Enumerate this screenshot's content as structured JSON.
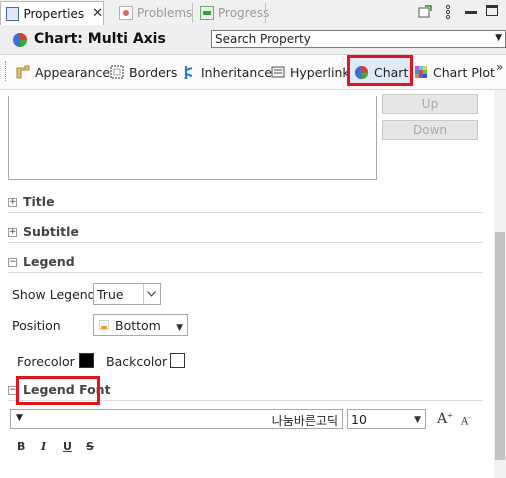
{
  "tabs": [
    {
      "label": "Properties",
      "icon": "properties-icon"
    },
    {
      "label": "Problems",
      "icon": "problems-icon"
    },
    {
      "label": "Progress",
      "icon": "progress-icon"
    }
  ],
  "header": {
    "title": "Chart: Multi Axis",
    "search_placeholder": "Search Property"
  },
  "toolbar": [
    {
      "label": "Appearance",
      "icon": "appearance-icon"
    },
    {
      "label": "Borders",
      "icon": "borders-icon"
    },
    {
      "label": "Inheritance",
      "icon": "inheritance-icon"
    },
    {
      "label": "Hyperlink",
      "icon": "hyperlink-icon"
    },
    {
      "label": "Chart",
      "icon": "chart-icon"
    },
    {
      "label": "Chart Plot",
      "icon": "chart-plot-icon"
    }
  ],
  "toolbar_overflow": "»",
  "list_buttons": {
    "up": "Up",
    "down": "Down"
  },
  "sections": {
    "title": "Title",
    "subtitle": "Subtitle",
    "legend": "Legend",
    "legend_font": "Legend Font"
  },
  "legend": {
    "show_legend_label": "Show Legend",
    "show_legend_value": "True",
    "position_label": "Position",
    "position_value": "Bottom",
    "forecolor_label": "Forecolor",
    "forecolor_value": "#000000",
    "backcolor_label": "Backcolor",
    "backcolor_value": "#ffffff"
  },
  "font": {
    "family": "나눔바른고딕",
    "size": "10",
    "grow": "A",
    "shrink": "A",
    "bold": "B",
    "italic": "I",
    "underline": "U",
    "strike": "S"
  },
  "colors": {
    "highlight": "#e2141c",
    "chart_icon_red": "#e23a2f",
    "chart_icon_blue": "#3a6fd8",
    "chart_icon_green": "#3faa3a"
  }
}
